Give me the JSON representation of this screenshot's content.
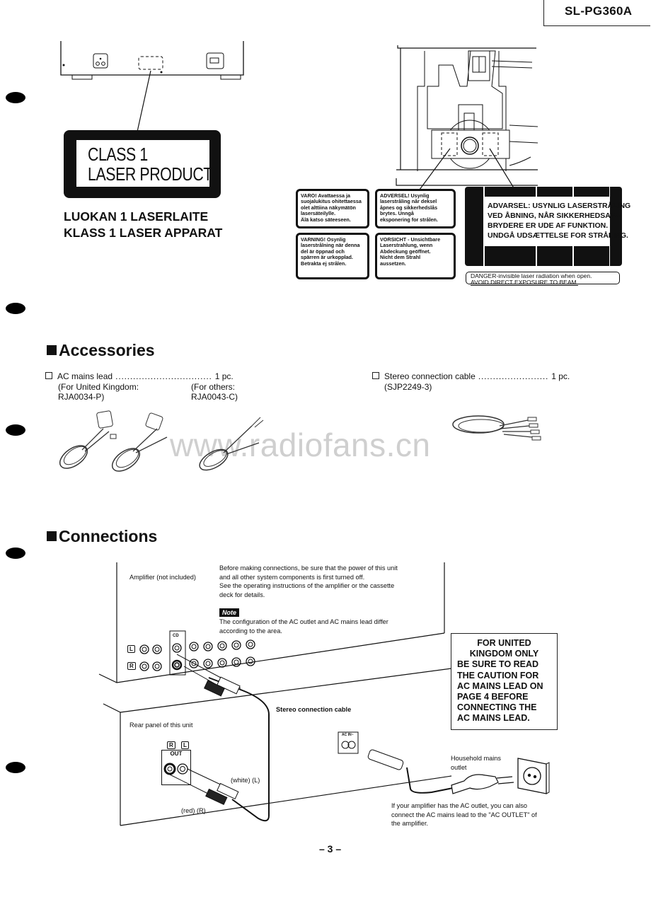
{
  "header": {
    "model": "SL-PG360A"
  },
  "laser_labels": {
    "class_label": [
      "CLASS 1",
      "LASER PRODUCT"
    ],
    "translations": [
      "LUOKAN 1 LASERLAITE",
      "KLASS 1 LASER APPARAT"
    ],
    "warnings": [
      {
        "lines": [
          "VARO! Avattaessa ja",
          "suojalukitus ohitettaessa",
          "olet alttiina näkymätön",
          "lasersäteilylle.",
          "Älä katso säteeseen."
        ]
      },
      {
        "lines": [
          "ADVERSEL! Usynlig",
          "laserstråling når deksel",
          "åpnes og sikkerhedslås",
          "brytes.        Unngå",
          "eksponering for strålen."
        ]
      },
      {
        "lines": [
          "VARNING! Osynlig",
          "laserstrålning när denna",
          "del är öppnad och",
          "spärren är urkopplad.",
          "Betrakta ej strålen."
        ]
      },
      {
        "lines": [
          "VORSICHT - Unsichtbare",
          "Laserstrahlung, wenn",
          "Abdeckung geöffnet.",
          "Nicht dem Strahl",
          "aussetzen."
        ]
      }
    ],
    "advarsel": [
      "ADVARSEL: USYNLIG LASERSTRÅLING",
      "VED ÅBNING,  NÅR SIKKERHEDSAF-",
      "BRYDERE ER UDE AF FUNKTION.",
      "UNDGÅ UDSÆTTELSE FOR STRÅLING."
    ],
    "danger": [
      "DANGER-invisible laser radiation when open.",
      "AVOID DIRECT EXPOSURE TO BEAM."
    ]
  },
  "accessories": {
    "title": "Accessories",
    "items": [
      {
        "name": "AC mains lead",
        "dots": " ................................. ",
        "qty": "1 pc.",
        "variants": [
          {
            "line1": "(For United Kingdom:",
            "line2": "RJA0034-P)"
          },
          {
            "line1": "(For others:",
            "line2": "RJA0043-C)"
          }
        ]
      },
      {
        "name": "Stereo connection cable",
        "dots": " ........................ ",
        "qty": "1 pc.",
        "part": "(SJP2249-3)"
      }
    ],
    "watermark": "www.radiofans.cn"
  },
  "connections": {
    "title": "Connections",
    "amplifier_label": "Amplifier (not included)",
    "intro": [
      "Before making connections, be sure that the power of this unit",
      "and all other system components is first turned off.",
      "See the operating instructions of the amplifier or the cassette",
      "deck for details."
    ],
    "note_label": "Note",
    "note_text": [
      "The configuration of the AC outlet and AC mains lead differ",
      "according to the area."
    ],
    "cd_label": "CD",
    "l_label": "L",
    "r_label": "R",
    "stereo_cable_label": "Stereo connection cable",
    "rear_panel_label": "Rear panel of this unit",
    "out_label": "OUT",
    "white_label": "(white) (L)",
    "red_label": "(red)  (R)",
    "ac_in_label": "AC IN~",
    "household_label": [
      "Household mains",
      "outlet"
    ],
    "ac_outlet_note": [
      "If your amplifier has the AC outlet, you can also",
      "connect the AC mains lead to the \"AC OUTLET\" of",
      "the amplifier."
    ],
    "uk_box": [
      "FOR UNITED",
      "KINGDOM ONLY",
      "BE SURE TO READ",
      "THE CAUTION FOR",
      "AC MAINS LEAD ON",
      "PAGE 4 BEFORE",
      "CONNECTING THE",
      "AC MAINS LEAD."
    ]
  },
  "footer": {
    "page_number": "– 3 –"
  }
}
